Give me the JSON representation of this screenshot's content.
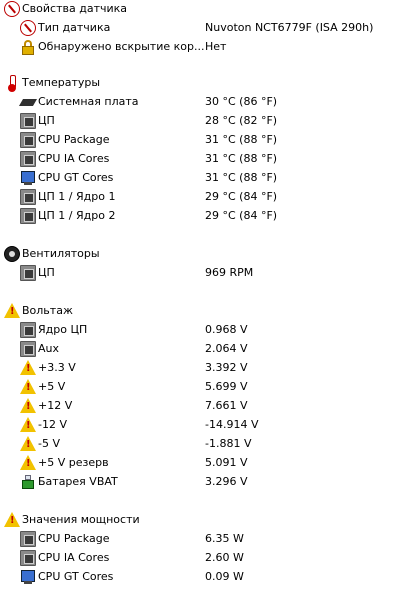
{
  "sensor_properties": {
    "title": "Свойства датчика",
    "icon": "sensor-properties-icon",
    "items": [
      {
        "label": "Тип датчика",
        "value": "Nuvoton NCT6779F  (ISA 290h)",
        "icon": "sensor-properties-icon"
      },
      {
        "label": "Обнаружено вскрытие кор...",
        "value": "Нет",
        "icon": "lock-icon"
      }
    ]
  },
  "temperatures": {
    "title": "Температуры",
    "icon": "thermometer-icon",
    "items": [
      {
        "label": "Системная плата",
        "value": "30 °C  (86 °F)",
        "icon": "motherboard-icon"
      },
      {
        "label": "ЦП",
        "value": "28 °C  (82 °F)",
        "icon": "chip-icon"
      },
      {
        "label": "CPU Package",
        "value": "31 °C  (88 °F)",
        "icon": "chip-icon"
      },
      {
        "label": "CPU IA Cores",
        "value": "31 °C  (88 °F)",
        "icon": "chip-icon"
      },
      {
        "label": "CPU GT Cores",
        "value": "31 °C  (88 °F)",
        "icon": "monitor-icon"
      },
      {
        "label": "ЦП 1 / Ядро 1",
        "value": "29 °C  (84 °F)",
        "icon": "chip-icon"
      },
      {
        "label": "ЦП 1 / Ядро 2",
        "value": "29 °C  (84 °F)",
        "icon": "chip-icon"
      }
    ]
  },
  "fans": {
    "title": "Вентиляторы",
    "icon": "fan-icon",
    "items": [
      {
        "label": "ЦП",
        "value": "969 RPM",
        "icon": "chip-icon"
      }
    ]
  },
  "voltages": {
    "title": "Вольтаж",
    "icon": "warning-icon",
    "items": [
      {
        "label": "Ядро ЦП",
        "value": "0.968 V",
        "icon": "chip-icon"
      },
      {
        "label": "Aux",
        "value": "2.064 V",
        "icon": "chip-icon"
      },
      {
        "label": "+3.3 V",
        "value": "3.392 V",
        "icon": "warning-icon"
      },
      {
        "label": "+5 V",
        "value": "5.699 V",
        "icon": "warning-icon"
      },
      {
        "label": "+12 V",
        "value": "7.661 V",
        "icon": "warning-icon"
      },
      {
        "label": "-12 V",
        "value": "-14.914 V",
        "icon": "warning-icon"
      },
      {
        "label": "-5 V",
        "value": "-1.881 V",
        "icon": "warning-icon"
      },
      {
        "label": "+5 V резерв",
        "value": "5.091 V",
        "icon": "warning-icon"
      },
      {
        "label": "Батарея VBAT",
        "value": "3.296 V",
        "icon": "battery-icon"
      }
    ]
  },
  "power": {
    "title": "Значения мощности",
    "icon": "warning-icon",
    "items": [
      {
        "label": "CPU Package",
        "value": "6.35 W",
        "icon": "chip-icon"
      },
      {
        "label": "CPU IA Cores",
        "value": "2.60 W",
        "icon": "chip-icon"
      },
      {
        "label": "CPU GT Cores",
        "value": "0.09 W",
        "icon": "monitor-icon"
      }
    ]
  }
}
